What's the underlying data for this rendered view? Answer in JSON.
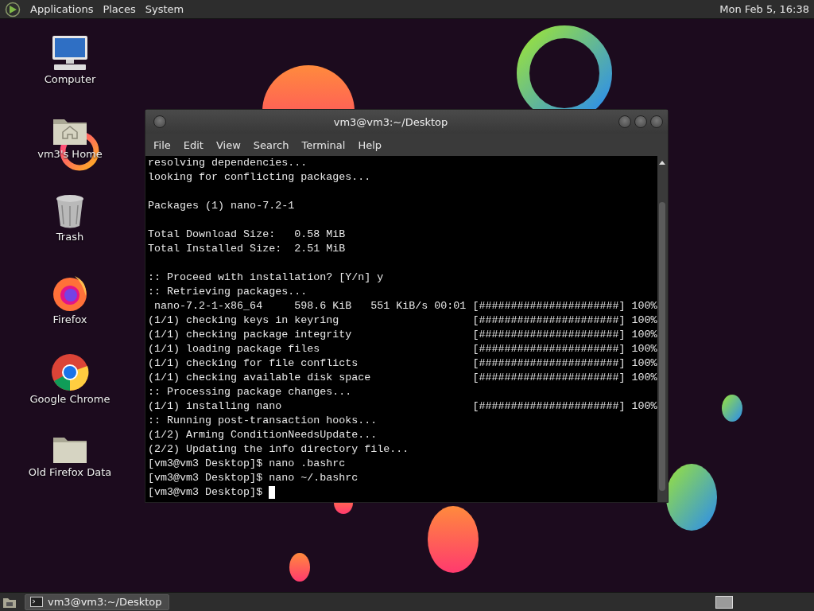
{
  "top_panel": {
    "menus": [
      "Applications",
      "Places",
      "System"
    ],
    "clock": "Mon Feb  5, 16:38"
  },
  "desktop_icons": [
    {
      "kind": "computer",
      "label": "Computer"
    },
    {
      "kind": "home",
      "label": "vm3's Home"
    },
    {
      "kind": "trash",
      "label": "Trash"
    },
    {
      "kind": "firefox",
      "label": "Firefox"
    },
    {
      "kind": "chrome",
      "label": "Google Chrome"
    },
    {
      "kind": "folder",
      "label": "Old Firefox Data"
    }
  ],
  "terminal": {
    "title": "vm3@vm3:~/Desktop",
    "menu": [
      "File",
      "Edit",
      "View",
      "Search",
      "Terminal",
      "Help"
    ],
    "paragraphs": [
      [
        "resolving dependencies...",
        "looking for conflicting packages..."
      ],
      [
        "Packages (1) nano-7.2-1"
      ],
      [
        "Total Download Size:   0.58 MiB",
        "Total Installed Size:  2.51 MiB"
      ],
      [
        ":: Proceed with installation? [Y/n] y",
        ":: Retrieving packages...",
        " nano-7.2-1-x86_64     598.6 KiB   551 KiB/s 00:01 [######################] 100%",
        "(1/1) checking keys in keyring                     [######################] 100%",
        "(1/1) checking package integrity                   [######################] 100%",
        "(1/1) loading package files                        [######################] 100%",
        "(1/1) checking for file conflicts                  [######################] 100%",
        "(1/1) checking available disk space                [######################] 100%",
        ":: Processing package changes...",
        "(1/1) installing nano                              [######################] 100%",
        ":: Running post-transaction hooks...",
        "(1/2) Arming ConditionNeedsUpdate...",
        "(2/2) Updating the info directory file...",
        "[vm3@vm3 Desktop]$ nano .bashrc",
        "[vm3@vm3 Desktop]$ nano ~/.bashrc",
        "[vm3@vm3 Desktop]$ "
      ]
    ]
  },
  "taskbar": {
    "tasks": [
      {
        "label": "vm3@vm3:~/Desktop"
      }
    ]
  }
}
